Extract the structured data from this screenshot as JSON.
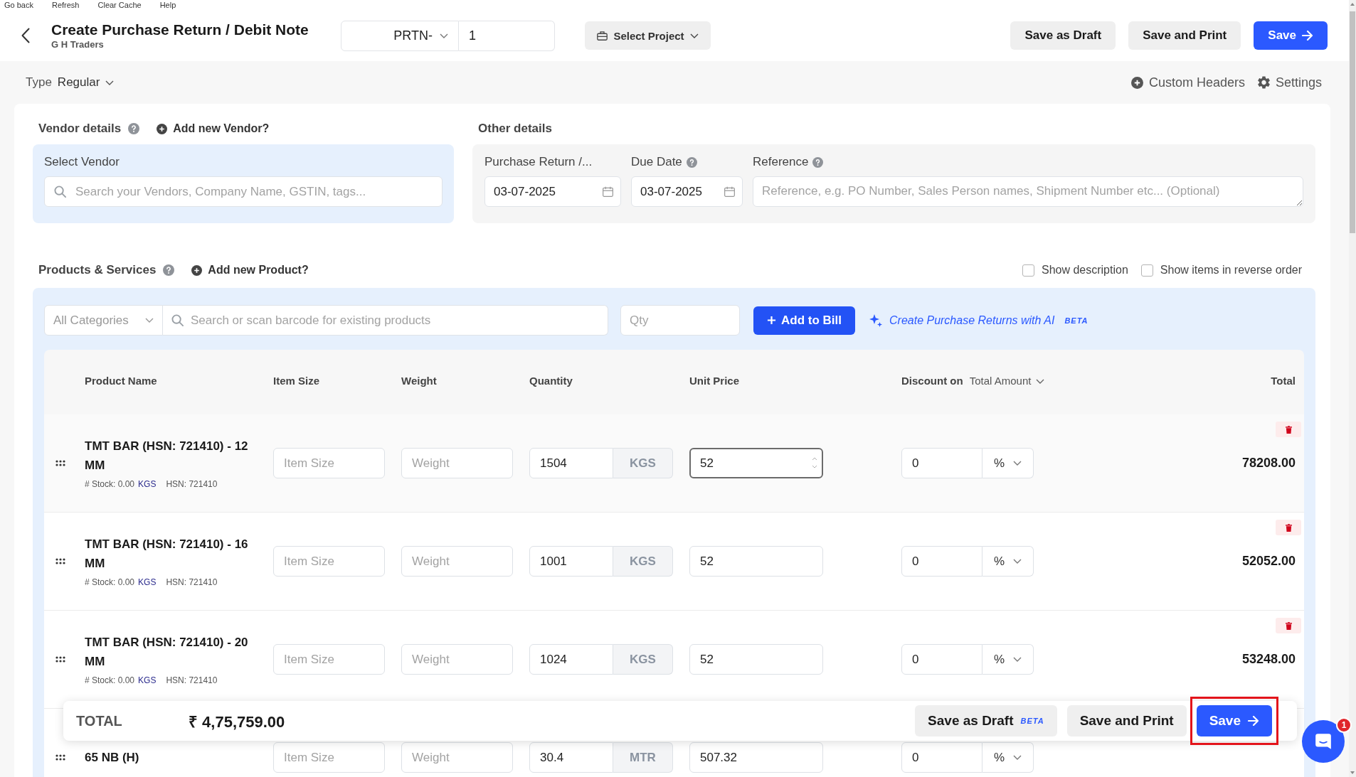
{
  "top_menu": [
    {
      "label": "Go back"
    },
    {
      "label": "Refresh"
    },
    {
      "label": "Clear Cache"
    },
    {
      "label": "Help"
    }
  ],
  "header": {
    "title": "Create Purchase Return / Debit Note",
    "subtitle": "G H Traders",
    "prefix": "PRTN-",
    "number": "1",
    "project": "Select Project",
    "buttons": [
      {
        "label": "Save as Draft",
        "kind": "secondary"
      },
      {
        "label": "Save and Print",
        "kind": "secondary"
      },
      {
        "label": "Save",
        "kind": "primary"
      }
    ]
  },
  "type": {
    "label": "Type",
    "value": "Regular"
  },
  "links": [
    {
      "label": "Custom Headers",
      "kind": "add"
    },
    {
      "label": "Settings",
      "kind": "settings"
    }
  ],
  "vendor": {
    "title": "Vendor details",
    "help": true,
    "add_link": "Add new Vendor?",
    "field_label": "Select Vendor",
    "placeholder": "Search your Vendors, Company Name, GSTIN, tags..."
  },
  "other_details": {
    "title": "Other details",
    "fields": [
      {
        "kind": "date",
        "label": "Purchase Return /...",
        "help": false,
        "value": "03-07-2025"
      },
      {
        "kind": "date",
        "label": "Due Date",
        "help": true,
        "value": "03-07-2025"
      },
      {
        "kind": "text",
        "label": "Reference",
        "help": true,
        "placeholder": "Reference, e.g. PO Number, Sales Person names, Shipment Number etc... (Optional)"
      }
    ]
  },
  "products": {
    "title": "Products & Services",
    "help": true,
    "add_link": "Add new Product?",
    "options": [
      {
        "label": "Show description",
        "checked": false
      },
      {
        "label": "Show items in reverse order",
        "checked": false
      }
    ],
    "category": "All Categories",
    "search_placeholder": "Search or scan barcode for existing products",
    "qty_placeholder": "Qty",
    "add_button": "Add to Bill",
    "ai_link": "Create Purchase Returns with AI",
    "ai_badge": "BETA"
  },
  "table": {
    "columns": {
      "product_name": "Product Name",
      "item_size": "Item Size",
      "weight": "Weight",
      "quantity": "Quantity",
      "unit_price": "Unit Price",
      "discount_on": "Discount on",
      "discount_basis": "Total Amount",
      "total": "Total"
    },
    "rows": [
      {
        "name": "TMT BAR (HSN: 721410) - 12 MM",
        "stock": "# Stock: 0.00",
        "stock_unit": "KGS",
        "hsn": "HSN: 721410",
        "item_size_placeholder": "Item Size",
        "weight_placeholder": "Weight",
        "quantity": "1504",
        "unit": "KGS",
        "unit_price": "52",
        "discount": "0",
        "discount_type": "%",
        "total": "78208.00",
        "active": true
      },
      {
        "name": "TMT BAR (HSN: 721410) - 16 MM",
        "stock": "# Stock: 0.00",
        "stock_unit": "KGS",
        "hsn": "HSN: 721410",
        "item_size_placeholder": "Item Size",
        "weight_placeholder": "Weight",
        "quantity": "1001",
        "unit": "KGS",
        "unit_price": "52",
        "discount": "0",
        "discount_type": "%",
        "total": "52052.00",
        "active": false
      },
      {
        "name": "TMT BAR (HSN: 721410) - 20 MM",
        "stock": "# Stock: 0.00",
        "stock_unit": "KGS",
        "hsn": "HSN: 721410",
        "item_size_placeholder": "Item Size",
        "weight_placeholder": "Weight",
        "quantity": "1024",
        "unit": "KGS",
        "unit_price": "52",
        "discount": "0",
        "discount_type": "%",
        "total": "53248.00",
        "active": false
      },
      {
        "name": "65 NB (H)",
        "item_size_placeholder": "Item Size",
        "weight_placeholder": "Weight",
        "quantity": "30.4",
        "unit": "MTR",
        "unit_price": "507.32",
        "discount": "0",
        "discount_type": "%",
        "active": false
      }
    ]
  },
  "footer": {
    "label": "TOTAL",
    "amount": "₹ 4,75,759.00",
    "buttons": [
      {
        "label": "Save as Draft",
        "kind": "secondary",
        "badge": "BETA",
        "highlighted": false
      },
      {
        "label": "Save and Print",
        "kind": "secondary",
        "highlighted": false
      },
      {
        "label": "Save",
        "kind": "primary",
        "highlighted": true
      }
    ]
  },
  "chat": {
    "count": "1"
  }
}
